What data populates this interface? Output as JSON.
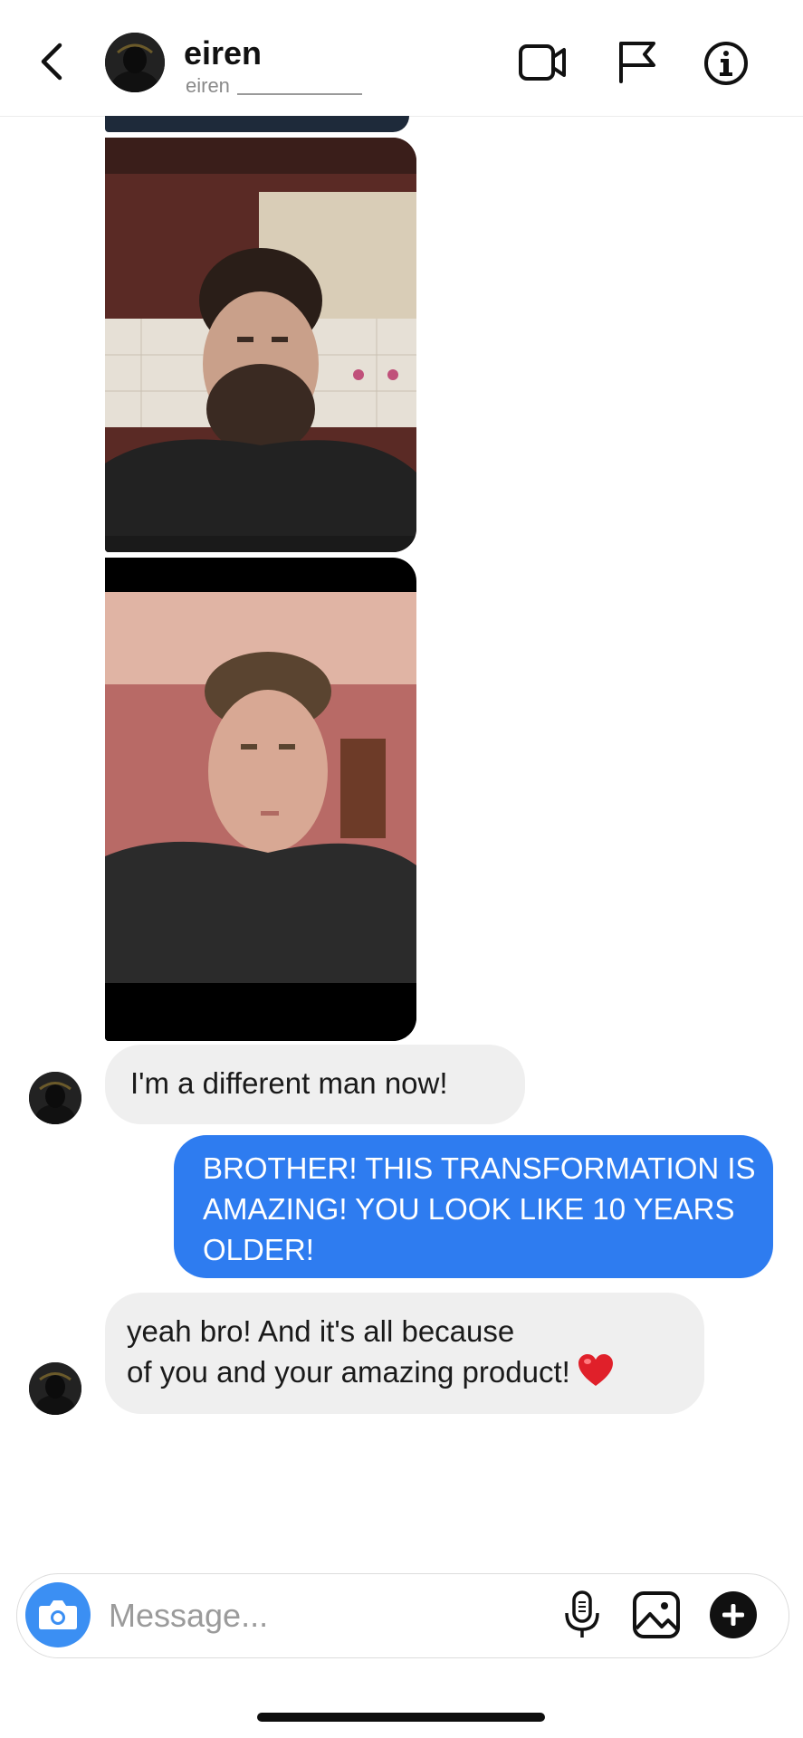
{
  "header": {
    "name": "eiren",
    "username": "eiren",
    "icons": [
      "back-arrow-icon",
      "video-call-icon",
      "flag-icon",
      "info-icon"
    ]
  },
  "messages": [
    {
      "type": "image",
      "from": "them",
      "description_icon": "photo"
    },
    {
      "type": "image",
      "from": "them",
      "description_icon": "photo"
    },
    {
      "type": "text",
      "from": "them",
      "text": "I'm a different man now!"
    },
    {
      "type": "text",
      "from": "me",
      "text": "BROTHER! THIS TRANSFORMATION IS AMAZING! YOU LOOK LIKE 10 YEARS OLDER!"
    },
    {
      "type": "text",
      "from": "them",
      "lines": [
        "yeah bro! And it's all because",
        "of you and your amazing product!"
      ],
      "emoji": "heart-emoji"
    }
  ],
  "composer": {
    "placeholder": "Message...",
    "icons": [
      "camera-icon",
      "microphone-icon",
      "gallery-icon",
      "plus-icon"
    ]
  },
  "colors": {
    "outgoing_bubble": "#2e7cf0",
    "incoming_bubble": "#efefef",
    "camera_button": "#3b8ff3"
  }
}
